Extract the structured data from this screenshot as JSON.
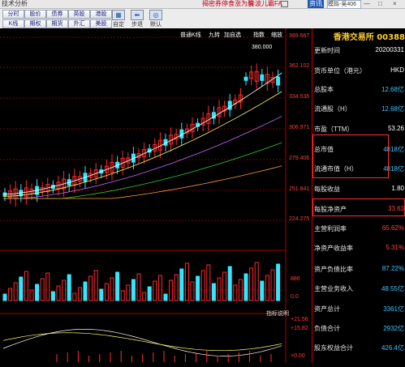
{
  "titlebar": {
    "app": "技术分析",
    "ad1": "揭密券停食涨为股",
    "ad2": "奔波儿霸FA",
    "menu": "资讯",
    "selector": "模拟-吴406",
    "ctrl_min": "—",
    "ctrl_max": "□",
    "ctrl_close": "×"
  },
  "toolbar": {
    "buttons": [
      [
        "分时",
        "股价",
        "债券",
        "英股",
        "港股"
      ],
      [
        "K线",
        "期权",
        "期货",
        "外汇",
        "美股"
      ]
    ],
    "icons": [
      {
        "glyph": "▦",
        "label": "自定"
      },
      {
        "glyph": "⬅",
        "label": "步退"
      },
      {
        "glyph": "◎",
        "label": "默认"
      }
    ]
  },
  "chart": {
    "header_labels": [
      "普通K线",
      "九转",
      "加自选",
      "指数",
      "缩放"
    ],
    "price_axis": [
      "389.667",
      "362.102",
      "334.536",
      "306.971",
      "279.406",
      "251.841",
      "224.275"
    ],
    "high_label": "380.000",
    "volume_axis": [
      "886",
      "0.0"
    ],
    "indicator_label": "指标说明",
    "indicator_axis": [
      "+21.56",
      "+15.82",
      "+0.00"
    ],
    "colors": {
      "up": "#ff2a2a",
      "down": "#33e7ff",
      "grid": "#7a0000",
      "ma_white": "#ffffff",
      "ma_yellow": "#ffff66",
      "ma_purple": "#cc66ff",
      "ma_green": "#33cc33",
      "ma_orange": "#ff9933"
    }
  },
  "panel": {
    "title": "香港交易所 00388",
    "rows": [
      {
        "k": "更新时间",
        "v": "20200331",
        "c": "white"
      },
      {
        "k": "货币单位（港元）",
        "v": "HKD",
        "c": "white"
      },
      {
        "k": "总股本",
        "v": "12.68亿",
        "c": "blue"
      },
      {
        "k": "流通股（H）",
        "v": "12.68亿",
        "c": "blue"
      },
      {
        "k": "市盈（TTM）",
        "v": "53.26",
        "c": "white"
      },
      {
        "k": "总市值",
        "v": "4818亿",
        "c": "blue"
      },
      {
        "k": "流通市值（H）",
        "v": "4818亿",
        "c": "blue"
      },
      {
        "k": "每股收益",
        "v": "1.80",
        "c": "white"
      },
      {
        "k": "每股净资产",
        "v": "33.63",
        "c": "red"
      },
      {
        "k": "主营利润率",
        "v": "65.62%",
        "c": "red"
      },
      {
        "k": "净资产收益率",
        "v": "5.31%",
        "c": "red"
      },
      {
        "k": "资产负债比率",
        "v": "87.22%",
        "c": "blue"
      },
      {
        "k": "主营业务收入",
        "v": "48.55亿",
        "c": "blue"
      },
      {
        "k": "资产总计",
        "v": "3361亿",
        "c": "blue"
      },
      {
        "k": "负债合计",
        "v": "2932亿",
        "c": "blue"
      },
      {
        "k": "股东权益合计",
        "v": "426.4亿",
        "c": "blue"
      }
    ]
  }
}
